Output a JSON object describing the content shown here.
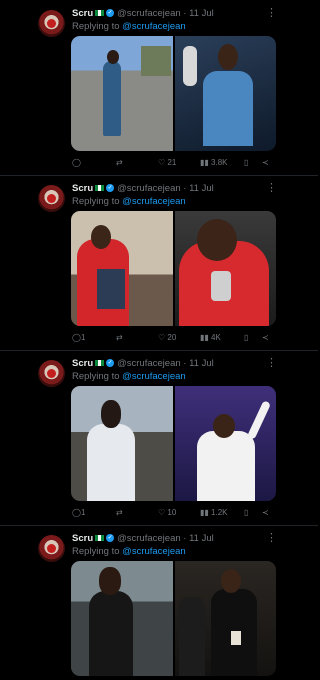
{
  "tweets": [
    {
      "name": "Scru",
      "handle": "@scrufacejean",
      "date": "· 11 Jul",
      "replying_label": "Replying to",
      "replying_handle": "@scrufacejean",
      "likes": "21",
      "views": "3.8K",
      "replies": "",
      "reposts": "",
      "media": [
        "man-walking-street-photo",
        "performer-with-microphone-photo"
      ]
    },
    {
      "name": "Scru",
      "handle": "@scrufacejean",
      "date": "· 11 Jul",
      "replying_label": "Replying to",
      "replying_handle": "@scrufacejean",
      "replies": "1",
      "reposts": "",
      "likes": "20",
      "views": "4K",
      "media": [
        "man-red-hoodie-room-photo",
        "man-red-hoodie-chain-photo"
      ]
    },
    {
      "name": "Scru",
      "handle": "@scrufacejean",
      "date": "· 11 Jul",
      "replying_label": "Replying to",
      "replying_handle": "@scrufacejean",
      "replies": "1",
      "reposts": "",
      "likes": "10",
      "views": "1.2K",
      "media": [
        "man-white-jacket-outdoor-photo",
        "performer-white-shirt-stage-photo"
      ]
    },
    {
      "name": "Scru",
      "handle": "@scrufacejean",
      "date": "· 11 Jul",
      "replying_label": "Replying to",
      "replying_handle": "@scrufacejean",
      "media": [
        "man-dark-outfit-street-photo",
        "group-dark-outfits-photo"
      ]
    }
  ]
}
